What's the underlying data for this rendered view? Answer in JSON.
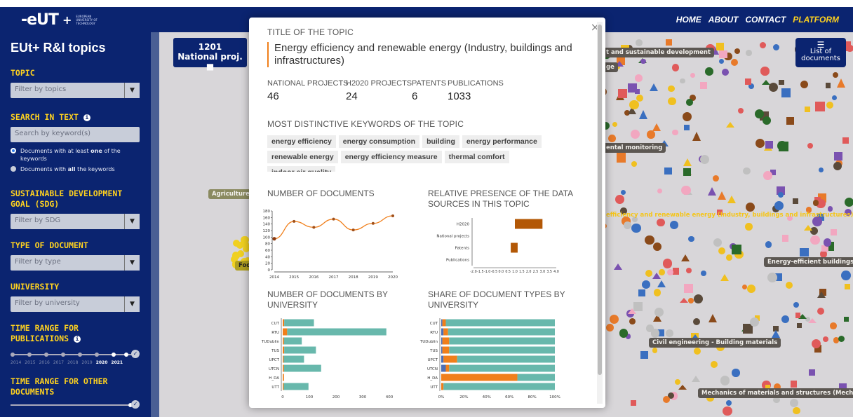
{
  "brand": {
    "logo_text": "-eUT",
    "logo_plus": "+",
    "logo_sub": "EUROPEAN UNIVERSITY OF TECHNOLOGY"
  },
  "nav": {
    "items": [
      {
        "label": "HOME",
        "active": false
      },
      {
        "label": "ABOUT",
        "active": false
      },
      {
        "label": "CONTACT",
        "active": false
      },
      {
        "label": "PLATFORM",
        "active": true
      }
    ]
  },
  "sidebar": {
    "title": "EUt+ R&I topics",
    "topic": {
      "heading": "TOPIC",
      "placeholder": "Filter by topics"
    },
    "search": {
      "heading": "SEARCH IN TEXT",
      "placeholder": "Search by keyword(s)",
      "option_any_pre": "Documents with at least ",
      "option_any_bold": "one",
      "option_any_post": " of the keywords",
      "option_all_pre": "Documents with ",
      "option_all_bold": "all",
      "option_all_post": " the keywords"
    },
    "sdg": {
      "heading": "SUSTAINABLE DEVELOPMENT GOAL (SDG)",
      "placeholder": "Filter by SDG"
    },
    "doc_type": {
      "heading": "TYPE OF DOCUMENT",
      "placeholder": "Filter by type"
    },
    "university": {
      "heading": "UNIVERSITY",
      "placeholder": "Filter by university"
    },
    "pub_range": {
      "heading": "TIME RANGE FOR PUBLICATIONS",
      "years": [
        "2014",
        "2015",
        "2016",
        "2017",
        "2018",
        "2019",
        "2020",
        "2021"
      ],
      "selected": [
        "2020",
        "2021"
      ]
    },
    "other_range": {
      "heading": "TIME RANGE FOR OTHER DOCUMENTS"
    }
  },
  "map": {
    "count_value": "1201",
    "count_label": "National proj. ■",
    "list_button_icon": "☰",
    "list_button_label": "List of documents",
    "labels": [
      {
        "text": "t and sustainable development",
        "style": "dark"
      },
      {
        "text": "ge",
        "style": "dark"
      },
      {
        "text": "ental monitoring",
        "style": "dark"
      },
      {
        "text": "efficiency and renewable energy (Industry, buildings and infrastructures)",
        "style": "yellow"
      },
      {
        "text": "Energy-efficient buildings and",
        "style": "dark"
      },
      {
        "text": "Civil engineering - Building materials",
        "style": "dark"
      },
      {
        "text": "Mechanics of materials and structures (Mechanical en",
        "style": "dark"
      },
      {
        "text": "Agriculture, f",
        "style": "dark"
      },
      {
        "text": "Foo",
        "style": "dark"
      }
    ]
  },
  "modal": {
    "close_icon": "×",
    "title_caption": "TITLE OF THE TOPIC",
    "topic_name": "Energy efficiency and renewable energy (Industry, buildings and infrastructures)",
    "stats": [
      {
        "label": "NATIONAL PROJECTS",
        "value": "46"
      },
      {
        "label": "H2020 PROJECTS",
        "value": "24"
      },
      {
        "label": "PATENTS",
        "value": "6"
      },
      {
        "label": "PUBLICATIONS",
        "value": "1033"
      }
    ],
    "keywords_caption": "MOST DISTINCTIVE KEYWORDS OF THE TOPIC",
    "keywords": [
      "energy efficiency",
      "energy consumption",
      "building",
      "energy performance",
      "renewable energy",
      "energy efficiency measure",
      "thermal comfort",
      "indoor air quality"
    ],
    "chart_titles": {
      "docs": "NUMBER OF DOCUMENTS",
      "presence": "RELATIVE PRESENCE OF THE DATA SOURCES IN THIS TOPIC",
      "by_univ": "NUMBER OF DOCUMENTS BY UNIVERSITY",
      "share": "SHARE OF DOCUMENT TYPES BY UNIVERSITY"
    }
  },
  "colors": {
    "navy": "#0b2470",
    "yellow": "#ffd21f",
    "orange": "#f07f1b",
    "teal": "#68b8ac",
    "brown": "#b35806",
    "blue": "#4d6fb6"
  },
  "chart_data": [
    {
      "type": "line",
      "title": "NUMBER OF DOCUMENTS",
      "x": [
        "2014",
        "2015",
        "2016",
        "2017",
        "2018",
        "2019",
        "2020"
      ],
      "values": [
        95,
        148,
        130,
        155,
        122,
        142,
        165
      ],
      "ylim": [
        0,
        180
      ],
      "yticks": [
        0,
        20,
        40,
        60,
        80,
        100,
        120,
        140,
        160,
        180
      ]
    },
    {
      "type": "bar",
      "title": "RELATIVE PRESENCE OF THE DATA SOURCES IN THIS TOPIC",
      "orientation": "horizontal",
      "categories": [
        "H2020",
        "National projects",
        "Patents",
        "Publications"
      ],
      "ranges": [
        [
          1.0,
          3.0
        ],
        null,
        [
          0.7,
          1.2
        ],
        null
      ],
      "xlim": [
        -2.0,
        4.0
      ],
      "xticks": [
        "-2.0",
        "-1.5",
        "-1.0",
        "-0.5",
        "0.0",
        "0.5",
        "1.0",
        "1.5",
        "2.0",
        "2.5",
        "3.0",
        "3.5",
        "4.0"
      ]
    },
    {
      "type": "bar",
      "title": "NUMBER OF DOCUMENTS BY UNIVERSITY",
      "orientation": "horizontal",
      "stacked": true,
      "categories": [
        "CUT",
        "RTU",
        "TUDublin",
        "TUS",
        "UPCT",
        "UTCN",
        "H_DA",
        "UTT"
      ],
      "series": [
        {
          "values": [
            6,
            18,
            5,
            6,
            4,
            5,
            5,
            4
          ],
          "color": "#f07f1b"
        },
        {
          "values": [
            120,
            400,
            72,
            128,
            82,
            150,
            0,
            100
          ],
          "color": "#68b8ac"
        }
      ],
      "xlim": [
        0,
        430
      ],
      "xticks": [
        0,
        100,
        200,
        300,
        400
      ]
    },
    {
      "type": "bar",
      "title": "SHARE OF DOCUMENT TYPES BY UNIVERSITY",
      "orientation": "horizontal",
      "stacked": true,
      "categories": [
        "CUT",
        "RTU",
        "TUDublin",
        "TUS",
        "UPCT",
        "UTCN",
        "H_DA",
        "UTT"
      ],
      "series": [
        {
          "values": [
            1,
            2,
            1,
            1,
            2,
            4,
            0,
            0
          ],
          "color": "#4d6fb6"
        },
        {
          "values": [
            3,
            4,
            6,
            6,
            12,
            3,
            67,
            2
          ],
          "color": "#f07f1b"
        },
        {
          "values": [
            96,
            94,
            93,
            93,
            86,
            93,
            33,
            98
          ],
          "color": "#68b8ac"
        }
      ],
      "xlim": [
        0,
        100
      ],
      "xticks": [
        "0%",
        "20%",
        "40%",
        "60%",
        "80%",
        "100%"
      ]
    }
  ]
}
